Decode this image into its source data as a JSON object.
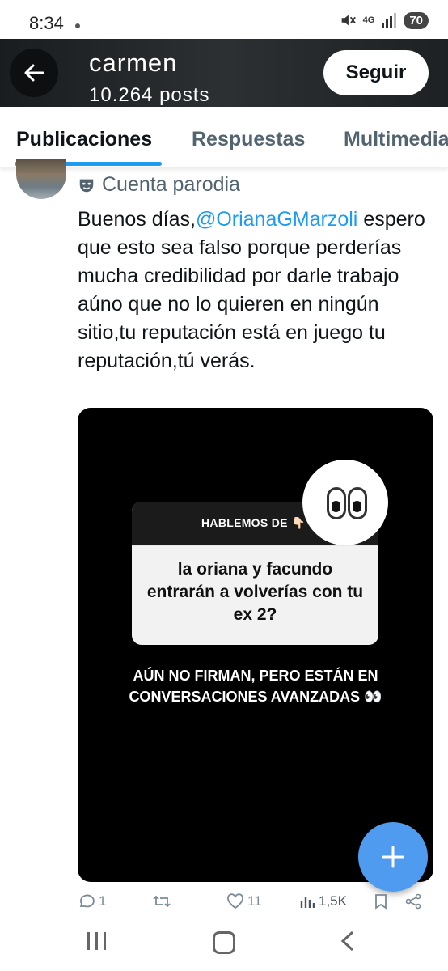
{
  "status_bar": {
    "time": "8:34",
    "network": "4G",
    "battery": "70"
  },
  "profile": {
    "name": "carmen",
    "posts": "10.264 posts",
    "follow_label": "Seguir"
  },
  "tabs": [
    {
      "label": "Publicaciones",
      "active": true
    },
    {
      "label": "Respuestas",
      "active": false
    },
    {
      "label": "Multimedia",
      "active": false
    }
  ],
  "tweet": {
    "account_label": "Cuenta parodia",
    "text_before": "Buenos días,",
    "mention": "@OrianaGMarzoli",
    "text_after": " espero que esto sea falso porque perderías mucha credibilidad por darle trabajo  aúno que no lo quieren en ningún sitio,tu reputación está en juego tu reputación,tú verás.",
    "media": {
      "box_header": "HABLEMOS DE 👇🏻",
      "question": "la oriana y facundo entrarán a volverías con tu ex 2?",
      "answer": "AÚN NO FIRMAN, PERO ESTÁN EN CONVERSACIONES AVANZADAS 👀"
    },
    "stats": {
      "replies": "1",
      "likes": "11",
      "views": "1,5K"
    }
  },
  "colors": {
    "accent": "#1d9bf0",
    "fab": "#4e9bf0",
    "muted": "#536471"
  },
  "icons": [
    "back-arrow-icon",
    "parody-mask-icon",
    "plus-icon",
    "reply-icon",
    "retweet-icon",
    "like-icon",
    "views-icon",
    "bookmark-icon",
    "share-icon"
  ]
}
